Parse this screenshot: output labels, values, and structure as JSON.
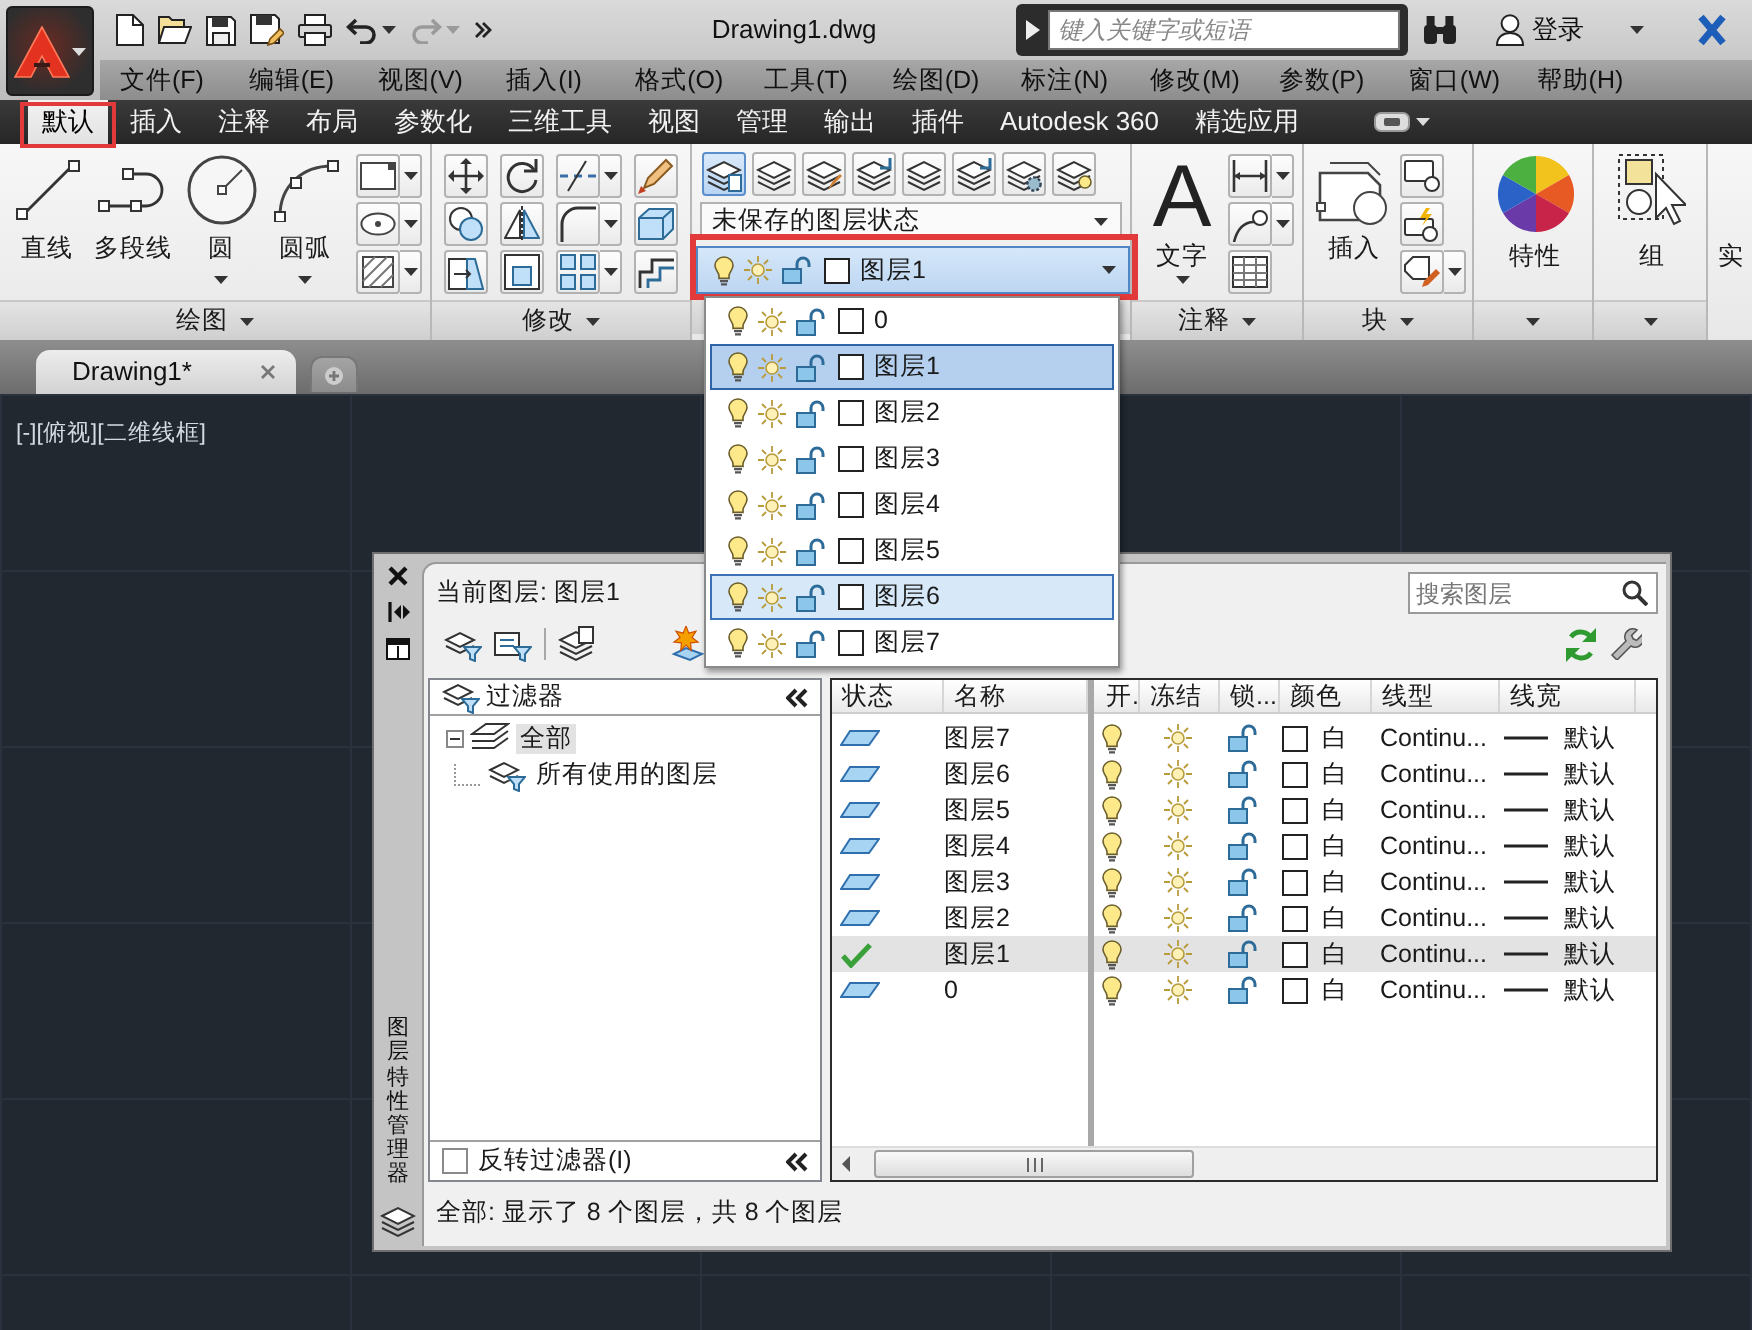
{
  "title_bar": {
    "title": "Drawing1.dwg",
    "redo_disabled": true,
    "search": {
      "placeholder": "键入关键字或短语"
    },
    "sign_in": "登录"
  },
  "menu": [
    "文件(F)",
    "编辑(E)",
    "视图(V)",
    "插入(I)",
    "格式(O)",
    "工具(T)",
    "绘图(D)",
    "标注(N)",
    "修改(M)",
    "参数(P)",
    "窗口(W)",
    "帮助(H)"
  ],
  "ribbon_tabs": [
    {
      "label": "默认",
      "selected": true,
      "highlighted": true
    },
    {
      "label": "插入",
      "selected": false,
      "highlighted": false
    },
    {
      "label": "注释",
      "selected": false,
      "highlighted": false
    },
    {
      "label": "布局",
      "selected": false,
      "highlighted": false
    },
    {
      "label": "参数化",
      "selected": false,
      "highlighted": false
    },
    {
      "label": "三维工具",
      "selected": false,
      "highlighted": false
    },
    {
      "label": "视图",
      "selected": false,
      "highlighted": false
    },
    {
      "label": "管理",
      "selected": false,
      "highlighted": false
    },
    {
      "label": "输出",
      "selected": false,
      "highlighted": false
    },
    {
      "label": "插件",
      "selected": false,
      "highlighted": false
    },
    {
      "label": "Autodesk 360",
      "selected": false,
      "highlighted": false
    },
    {
      "label": "精选应用",
      "selected": false,
      "highlighted": false
    }
  ],
  "ribbon": {
    "draw": {
      "title": "绘图",
      "buttons": [
        "直线",
        "多段线",
        "圆",
        "圆弧"
      ]
    },
    "modify": {
      "title": "修改"
    },
    "layers": {
      "properties_active": true,
      "state": "未保存的图层状态",
      "current": {
        "name": "图层1",
        "on": true,
        "frozen": false,
        "locked": false
      },
      "highlighted": true
    },
    "annotation": {
      "title": "注释",
      "glyph": "A",
      "buttons": [
        "文字"
      ]
    },
    "block": {
      "title": "块",
      "buttons": [
        "插入"
      ]
    },
    "properties": {
      "buttons": [
        "特性"
      ]
    },
    "groups": {
      "buttons": [
        "组"
      ]
    },
    "utilities": {
      "buttons": [
        "实"
      ]
    }
  },
  "file_tabs": [
    {
      "label": "Drawing1*",
      "selected": true
    }
  ],
  "viewport": {
    "label": "[-][俯视][二维线框]"
  },
  "layer_dropdown": {
    "items": [
      {
        "name": "0",
        "on": true,
        "frozen": false,
        "locked": false,
        "selected": false,
        "hovered": false
      },
      {
        "name": "图层1",
        "on": true,
        "frozen": false,
        "locked": false,
        "selected": true,
        "hovered": false
      },
      {
        "name": "图层2",
        "on": true,
        "frozen": false,
        "locked": false,
        "selected": false,
        "hovered": false
      },
      {
        "name": "图层3",
        "on": true,
        "frozen": false,
        "locked": false,
        "selected": false,
        "hovered": false
      },
      {
        "name": "图层4",
        "on": true,
        "frozen": false,
        "locked": false,
        "selected": false,
        "hovered": false
      },
      {
        "name": "图层5",
        "on": true,
        "frozen": false,
        "locked": false,
        "selected": false,
        "hovered": false
      },
      {
        "name": "图层6",
        "on": true,
        "frozen": false,
        "locked": false,
        "selected": false,
        "hovered": true
      },
      {
        "name": "图层7",
        "on": true,
        "frozen": false,
        "locked": false,
        "selected": false,
        "hovered": false
      }
    ]
  },
  "layer_manager": {
    "title": "图层特性管理器",
    "current": "当前图层: 图层1",
    "search": {
      "placeholder": "搜索图层"
    },
    "filters": {
      "title": "过滤器",
      "tree": [
        {
          "label": "全部",
          "expanded": true,
          "selected": true,
          "children": [
            {
              "label": "所有使用的图层",
              "selected": false
            }
          ]
        }
      ],
      "invert": {
        "label": "反转过滤器(I)",
        "checked": false
      }
    },
    "table": {
      "columns": [
        "状态",
        "名称",
        "开.",
        "冻结",
        "锁...",
        "颜色",
        "线型",
        "线宽"
      ],
      "rows": [
        {
          "current": false,
          "name": "图层7",
          "on": true,
          "frozen": false,
          "locked": false,
          "color_name": "白",
          "linetype": "Continu...",
          "lineweight": "默认",
          "selected": false
        },
        {
          "current": false,
          "name": "图层6",
          "on": true,
          "frozen": false,
          "locked": false,
          "color_name": "白",
          "linetype": "Continu...",
          "lineweight": "默认",
          "selected": false
        },
        {
          "current": false,
          "name": "图层5",
          "on": true,
          "frozen": false,
          "locked": false,
          "color_name": "白",
          "linetype": "Continu...",
          "lineweight": "默认",
          "selected": false
        },
        {
          "current": false,
          "name": "图层4",
          "on": true,
          "frozen": false,
          "locked": false,
          "color_name": "白",
          "linetype": "Continu...",
          "lineweight": "默认",
          "selected": false
        },
        {
          "current": false,
          "name": "图层3",
          "on": true,
          "frozen": false,
          "locked": false,
          "color_name": "白",
          "linetype": "Continu...",
          "lineweight": "默认",
          "selected": false
        },
        {
          "current": false,
          "name": "图层2",
          "on": true,
          "frozen": false,
          "locked": false,
          "color_name": "白",
          "linetype": "Continu...",
          "lineweight": "默认",
          "selected": false
        },
        {
          "current": true,
          "name": "图层1",
          "on": true,
          "frozen": false,
          "locked": false,
          "color_name": "白",
          "linetype": "Continu...",
          "lineweight": "默认",
          "selected": true
        },
        {
          "current": false,
          "name": "0",
          "on": true,
          "frozen": false,
          "locked": false,
          "color_name": "白",
          "linetype": "Continu...",
          "lineweight": "默认",
          "selected": false
        }
      ]
    },
    "status": "全部: 显示了 8 个图层，共 8 个图层"
  }
}
